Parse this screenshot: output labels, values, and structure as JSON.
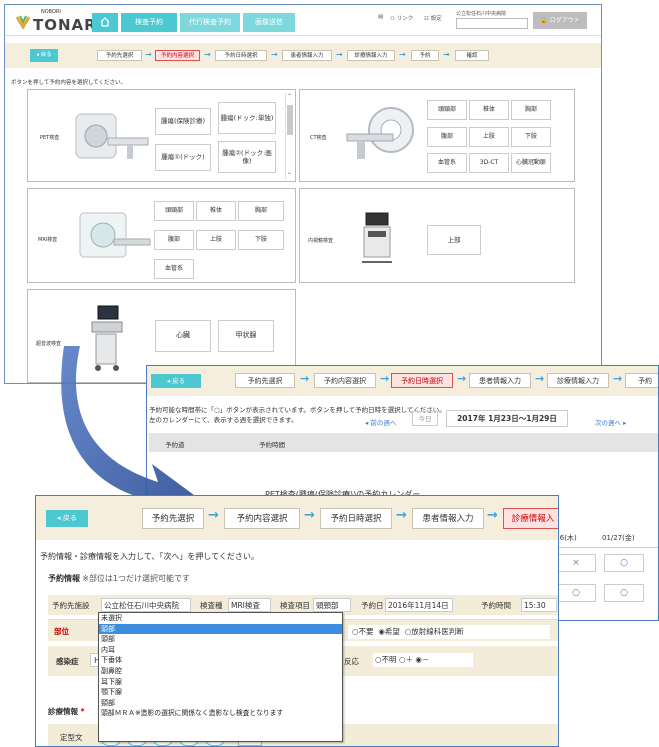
{
  "w1": {
    "logo_small": "NOBORI",
    "logo_big": "TONARI",
    "nav": [
      "検査予約",
      "代行検査予約",
      "画像送信"
    ],
    "hdr_links": [
      "リンク",
      "設定"
    ],
    "hospital": "公立松任石川中央病院",
    "logout": "ログアウト",
    "back": "◂ 戻る",
    "steps": [
      "予約先選択",
      "予約内容選択",
      "予約日時選択",
      "患者情報入力",
      "診療情報入力",
      "予約",
      "確認"
    ],
    "instruction": "ボタンを押して予約内容を選択してください。",
    "pet": {
      "label": "PET検査",
      "items": [
        "腫瘍(保険診療)",
        "腫瘍(ドック:単独)",
        "腫瘍①(ドック)",
        "腫瘍②(ドック:画像)"
      ]
    },
    "ct": {
      "label": "CT検査",
      "items": [
        "頭頸部",
        "椎体",
        "胸部",
        "腹部",
        "上肢",
        "下肢",
        "血管系",
        "3D-CT",
        "心臓冠動脈"
      ]
    },
    "mri": {
      "label": "MRI検査",
      "items": [
        "頭頸部",
        "椎体",
        "胸部",
        "腹部",
        "上肢",
        "下肢",
        "血管系"
      ]
    },
    "endo": {
      "label": "内視鏡検査",
      "items": [
        "上部"
      ]
    },
    "us": {
      "label": "超音波検査",
      "items": [
        "心臓",
        "甲状腺"
      ]
    }
  },
  "w2": {
    "back": "◂ 戻る",
    "steps": [
      "予約先選択",
      "予約内容選択",
      "予約日時選択",
      "患者情報入力",
      "診療情報入力",
      "予約"
    ],
    "instr1": "予約可能な時間帯に「○」ボタンが表示されています。ボタンを押して予約日時を選択してください。",
    "instr2": "左のカレンダーにて、表示する週を選択できます。",
    "prev_week": "◂ 前の週へ",
    "today": "今日",
    "week_range": "2017年 1月23日〜1月29日",
    "next_week": "次の週へ ▸",
    "col_area": "予約道",
    "col_time": "予約時間",
    "calendar_title": "PET検査(腫瘍(保険診療))の予約カレンダー",
    "dates": [
      "/26(木)",
      "01/27(金)"
    ],
    "marks": [
      "×",
      "○",
      "○",
      "○"
    ]
  },
  "w3": {
    "back": "◂ 戻る",
    "steps": [
      "予約先選択",
      "予約内容選択",
      "予約日時選択",
      "患者情報入力",
      "診療情報入"
    ],
    "instruction": "予約情報・診療情報を入力して、「次へ」を押してください。",
    "section1": "予約情報",
    "section1_note": "※部位は1つだけ選択可能です",
    "info": [
      {
        "k": "予約先施設",
        "v": "公立松任石川中央病院"
      },
      {
        "k": "検査種",
        "v": "MRI検査"
      },
      {
        "k": "検査項目",
        "v": "頭頸部"
      },
      {
        "k": "予約日",
        "v": "2016年11月14日"
      },
      {
        "k": "予約時間",
        "v": "15:30"
      }
    ],
    "bui": "部位",
    "kansen": "感染症",
    "kansen_prefix": "H",
    "contrast": [
      "○不要",
      "◉希望",
      "○放射線科医判断"
    ],
    "hannou_label": "反応",
    "hannou": [
      "○不明",
      "○＋",
      "◉－"
    ],
    "section2": "診療情報",
    "section2_star": "*",
    "teikei": "定型文",
    "teikei_nums": [
      "1",
      "2",
      "3",
      "4",
      "5"
    ],
    "teikei_btn": "適"
  },
  "dropdown": [
    "未選択",
    "頭部",
    "頭部",
    "内耳",
    "下垂体",
    "副鼻腔",
    "耳下腺",
    "顎下腺",
    "頸部",
    "頭部ＭＲＡ※造影の選択に関係なく造影なし検査となります"
  ],
  "colors": {
    "accent": "#4cc8d0",
    "active_step": "#e05050",
    "arrow": "#3aa6e0",
    "window_border": "#4a7bbf",
    "big_arrow": "#3b5fa8"
  }
}
